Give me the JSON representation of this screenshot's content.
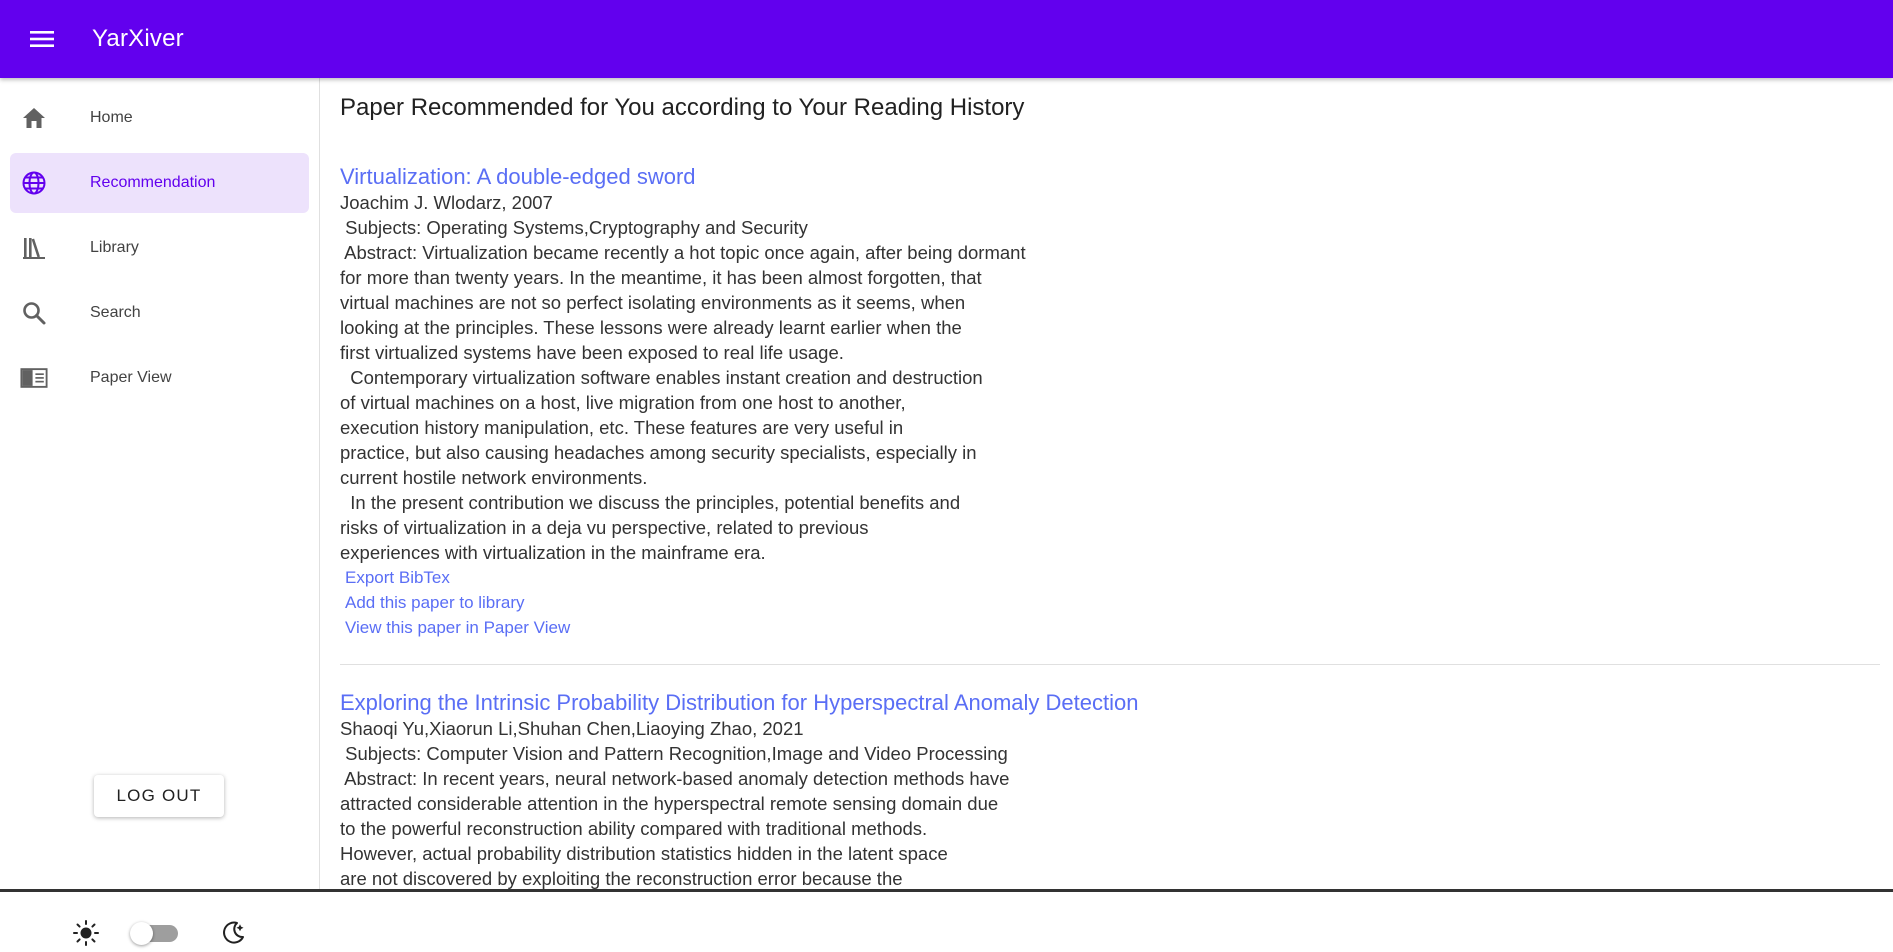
{
  "app": {
    "title": "YarXiver",
    "brand_color": "#6200ee",
    "menu_icon": "menu-icon"
  },
  "sidebar": {
    "items": [
      {
        "label": "Home",
        "icon": "home-icon"
      },
      {
        "label": "Recommendation",
        "icon": "globe-icon",
        "active": true
      },
      {
        "label": "Library",
        "icon": "library-icon"
      },
      {
        "label": "Search",
        "icon": "search-icon"
      },
      {
        "label": "Paper View",
        "icon": "paper-view-icon"
      }
    ],
    "logout_label": "LOG OUT",
    "theme_toggle": {
      "light_icon": "sun-icon",
      "dark_icon": "moon-icon",
      "dark_mode": false
    }
  },
  "main": {
    "title": "Paper Recommended for You according to Your Reading History",
    "papers": [
      {
        "title": "Virtualization: A double-edged sword",
        "authors_year": "Joachim J. Wlodarz, 2007",
        "subjects": " Subjects: Operating Systems,Cryptography and Security",
        "abstract_lines": [
          " Abstract: Virtualization became recently a hot topic once again, after being dormant",
          "for more than twenty years. In the meantime, it has been almost forgotten, that",
          "virtual machines are not so perfect isolating environments as it seems, when",
          "looking at the principles. These lessons were already learnt earlier when the",
          "first virtualized systems have been exposed to real life usage.",
          "  Contemporary virtualization software enables instant creation and destruction",
          "of virtual machines on a host, live migration from one host to another,",
          "execution history manipulation, etc. These features are very useful in",
          "practice, but also causing headaches among security specialists, especially in",
          "current hostile network environments.",
          "  In the present contribution we discuss the principles, potential benefits and",
          "risks of virtualization in a deja vu perspective, related to previous",
          "experiences with virtualization in the mainframe era."
        ],
        "links": {
          "export": "Export BibTex",
          "add": "Add this paper to library",
          "view": "View this paper in Paper View"
        }
      },
      {
        "title": "Exploring the Intrinsic Probability Distribution for Hyperspectral Anomaly Detection",
        "authors_year": "Shaoqi Yu,Xiaorun Li,Shuhan Chen,Liaoying Zhao, 2021",
        "subjects": " Subjects: Computer Vision and Pattern Recognition,Image and Video Processing",
        "abstract_lines": [
          " Abstract: In recent years, neural network-based anomaly detection methods have",
          "attracted considerable attention in the hyperspectral remote sensing domain due",
          "to the powerful reconstruction ability compared with traditional methods.",
          "However, actual probability distribution statistics hidden in the latent space",
          "are not discovered by exploiting the reconstruction error because the"
        ]
      }
    ]
  },
  "colors": {
    "link": "#5a6ef5",
    "active_bg": "#ede2fc"
  }
}
